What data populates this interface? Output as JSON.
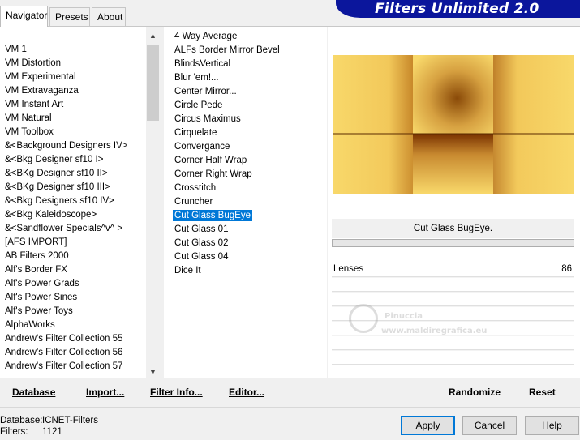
{
  "tabs": [
    {
      "label": "Navigator",
      "active": true
    },
    {
      "label": "Presets",
      "active": false
    },
    {
      "label": "About",
      "active": false
    }
  ],
  "banner": {
    "title": "Filters Unlimited 2.0",
    "color": "#0b169c"
  },
  "categories": [
    "VM 1",
    "VM Distortion",
    "VM Experimental",
    "VM Extravaganza",
    "VM Instant Art",
    "VM Natural",
    "VM Toolbox",
    "&<Background Designers IV>",
    "&<Bkg Designer sf10 I>",
    "&<BKg Designer sf10 II>",
    "&<BKg Designer sf10 III>",
    "&<Bkg Designers sf10 IV>",
    "&<Bkg Kaleidoscope>",
    "&<Sandflower Specials^v^ >",
    "[AFS IMPORT]",
    "AB Filters 2000",
    "Alf's Border FX",
    "Alf's Power Grads",
    "Alf's Power Sines",
    "Alf's Power Toys",
    "AlphaWorks",
    "Andrew's Filter Collection 55",
    "Andrew's Filter Collection 56",
    "Andrew's Filter Collection 57"
  ],
  "filters": [
    "4 Way Average",
    "ALFs Border Mirror Bevel",
    "BlindsVertical",
    "Blur 'em!...",
    "Center Mirror...",
    "Circle Pede",
    "Circus Maximus",
    "Cirquelate",
    "Convergance",
    "Corner Half Wrap",
    "Corner Right Wrap",
    "Crosstitch",
    "Cruncher",
    "Cut Glass  BugEye",
    "Cut Glass 01",
    "Cut Glass 02",
    "Cut Glass 04",
    "Dice It"
  ],
  "selected_filter_index": 13,
  "selected_filter_name": "Cut Glass  BugEye.",
  "parameter": {
    "label": "Lenses",
    "value": "86"
  },
  "watermark": {
    "line1": "Pinuccia",
    "line2": "www.maldiregrafica.eu"
  },
  "links": {
    "database": "Database",
    "import": "Import...",
    "filter_info": "Filter Info...",
    "editor": "Editor...",
    "randomize": "Randomize",
    "reset": "Reset"
  },
  "footer": {
    "database_label": "Database:",
    "database_value": "ICNET-Filters",
    "filters_label": "Filters:",
    "filters_value": "1121"
  },
  "buttons": {
    "apply": "Apply",
    "cancel": "Cancel",
    "help": "Help"
  },
  "colors": {
    "selection": "#0078d7",
    "preview_base": "#f8d86a",
    "preview_dark": "#8a4a08"
  }
}
